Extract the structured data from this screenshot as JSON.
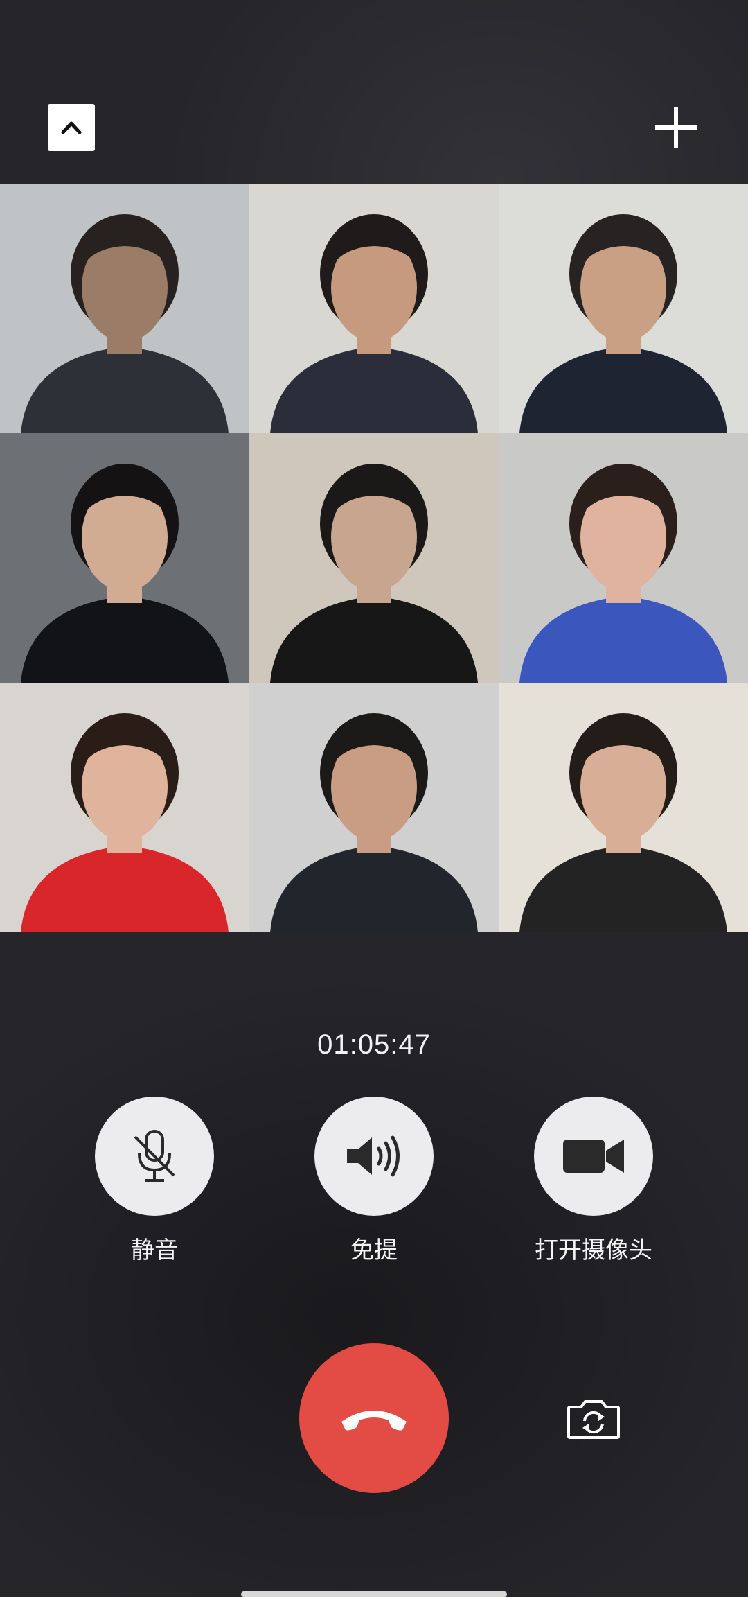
{
  "call": {
    "duration": "01:05:47"
  },
  "top_bar": {
    "collapse_icon": "chevron-up-icon",
    "add_icon": "plus-icon"
  },
  "participants": [
    {
      "tile": 1,
      "bg": "#bfc3c6",
      "shirt": "#2d3036",
      "skin": "#9a7c67",
      "hair": "#27221f"
    },
    {
      "tile": 2,
      "bg": "#d9d7d2",
      "shirt": "#2b2e3a",
      "skin": "#c59a7e",
      "hair": "#1e1b1a"
    },
    {
      "tile": 3,
      "bg": "#dcdcd8",
      "shirt": "#1f2433",
      "skin": "#c9a084",
      "hair": "#262322"
    },
    {
      "tile": 4,
      "bg": "#6d7074",
      "shirt": "#121316",
      "skin": "#d2ab93",
      "hair": "#141213"
    },
    {
      "tile": 5,
      "bg": "#cfc7bb",
      "shirt": "#171717",
      "skin": "#c7a58f",
      "hair": "#1b1918"
    },
    {
      "tile": 6,
      "bg": "#c9cac8",
      "shirt": "#3b57bd",
      "skin": "#e0b39e",
      "hair": "#2a1f1b"
    },
    {
      "tile": 7,
      "bg": "#d8d4cf",
      "shirt": "#d9262b",
      "skin": "#e0b49c",
      "hair": "#2a1c16"
    },
    {
      "tile": 8,
      "bg": "#cfd0cf",
      "shirt": "#22252c",
      "skin": "#c99d83",
      "hair": "#1c1a19"
    },
    {
      "tile": 9,
      "bg": "#e6e1d8",
      "shirt": "#232323",
      "skin": "#d8ae97",
      "hair": "#231c18"
    }
  ],
  "controls": {
    "mute": {
      "label": "静音",
      "icon": "microphone-muted-icon"
    },
    "speaker": {
      "label": "免提",
      "icon": "speaker-icon"
    },
    "camera": {
      "label": "打开摄像头",
      "icon": "video-camera-icon"
    },
    "hangup": {
      "icon": "phone-hangup-icon",
      "color": "#e34b45"
    },
    "switch_camera": {
      "icon": "switch-camera-icon"
    }
  }
}
